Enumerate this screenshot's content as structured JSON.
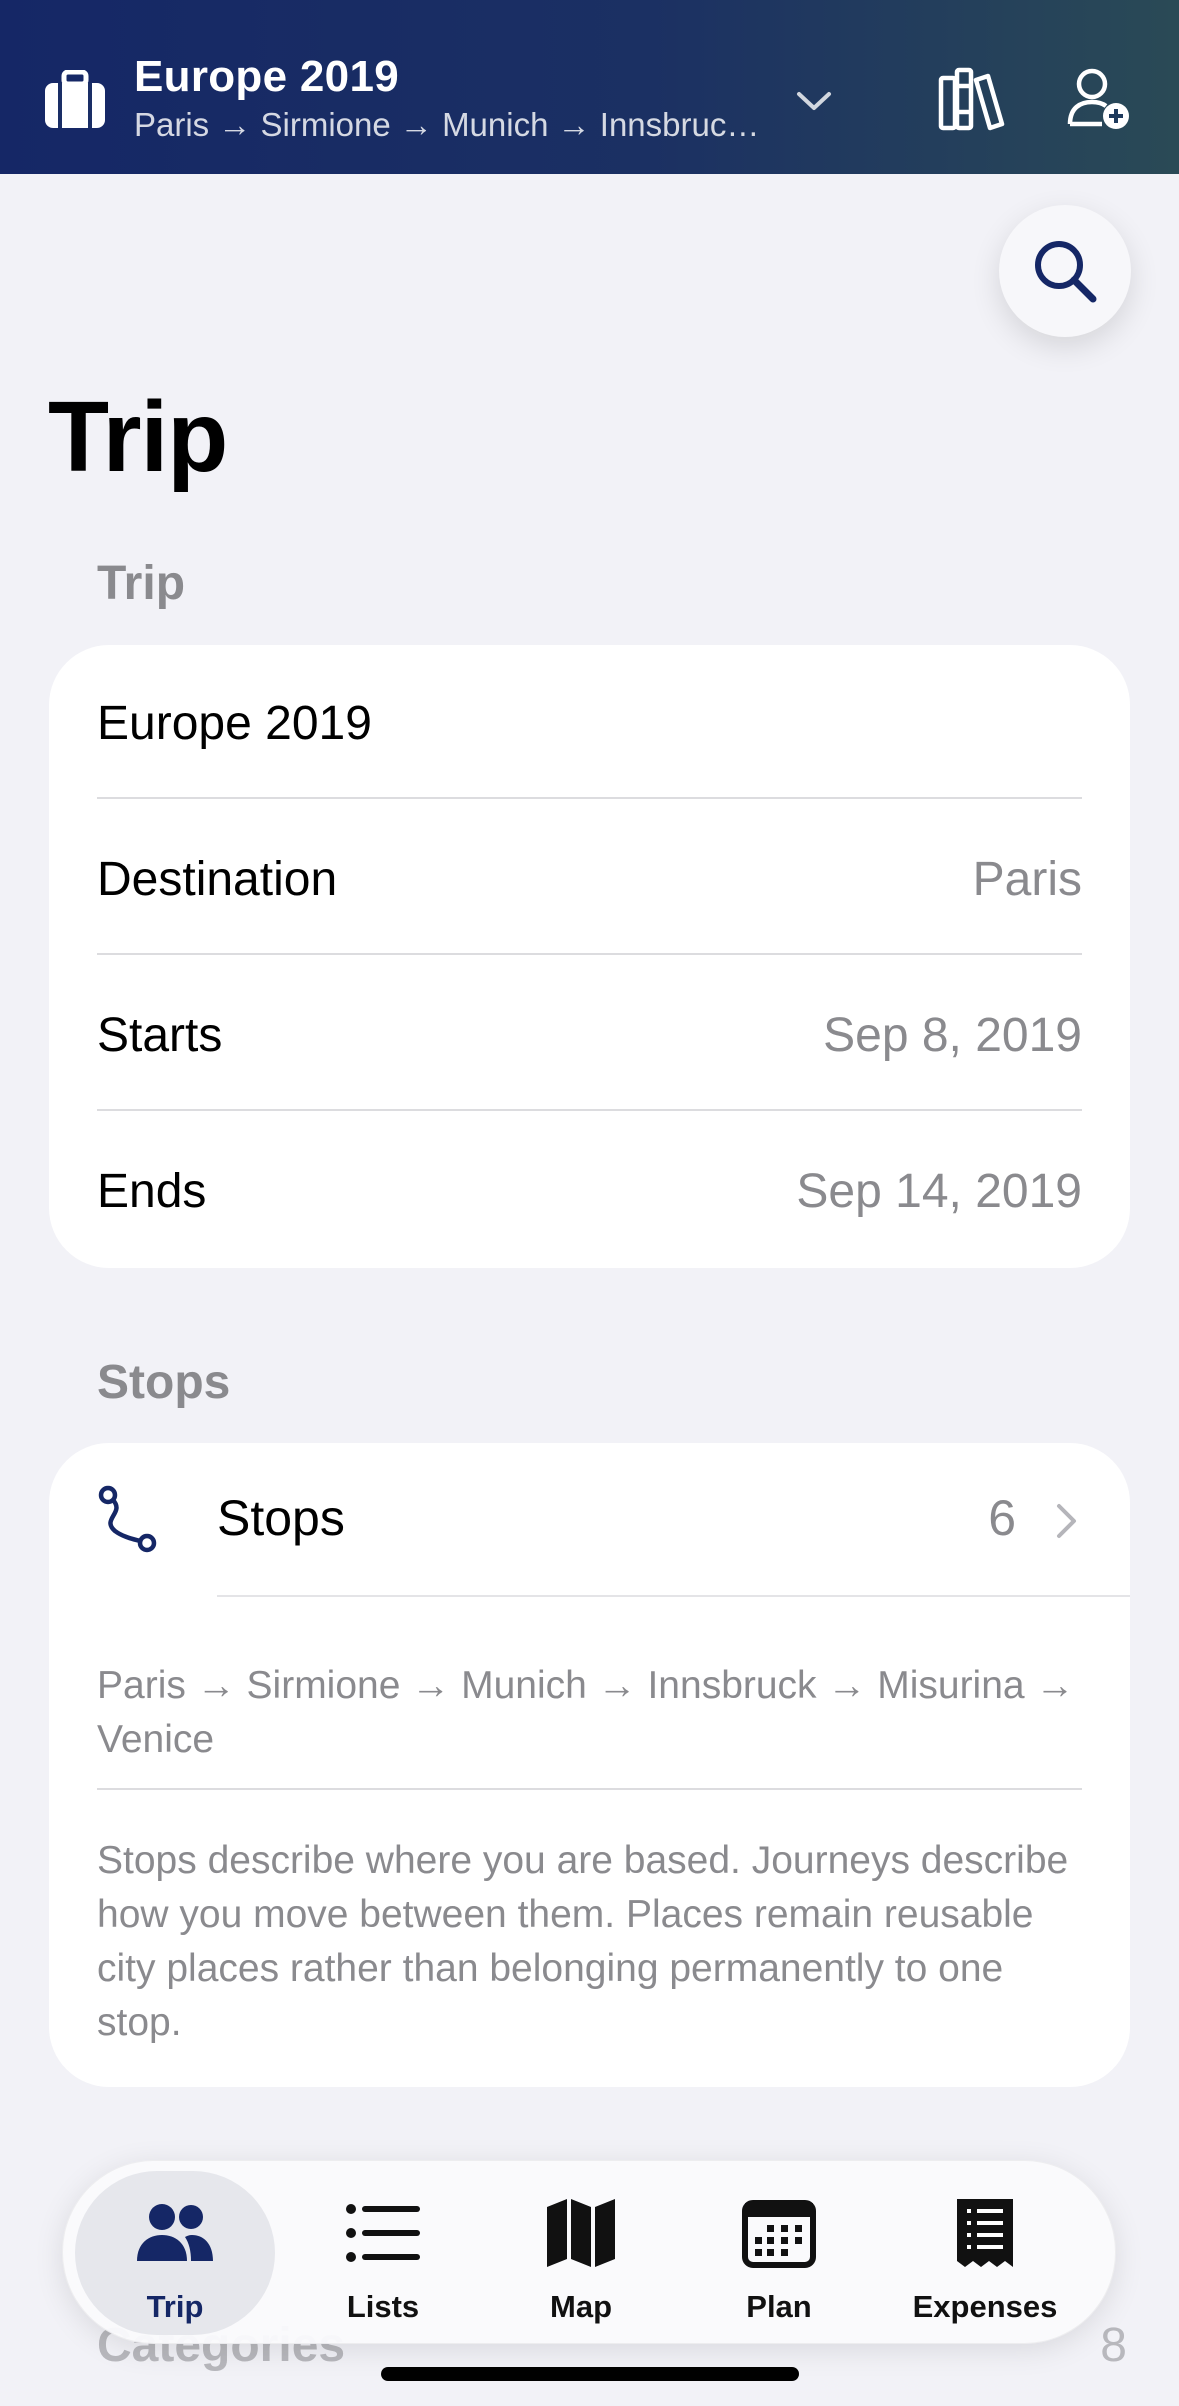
{
  "header": {
    "title": "Europe 2019",
    "route": "Paris → Sirmione → Munich → Innsbruc…"
  },
  "page": {
    "title": "Trip"
  },
  "trip_section": {
    "label": "Trip",
    "name": "Europe 2019",
    "rows": [
      {
        "label": "Destination",
        "value": "Paris"
      },
      {
        "label": "Starts",
        "value": "Sep 8, 2019"
      },
      {
        "label": "Ends",
        "value": "Sep 14, 2019"
      }
    ]
  },
  "stops_section": {
    "label": "Stops",
    "row_label": "Stops",
    "count": "6",
    "route": "Paris → Sirmione → Munich → Innsbruck → Misurina → Venice",
    "note": "Stops describe where you are based. Journeys describe how you move between them. Places remain reusable city places rather than belonging permanently to one stop."
  },
  "behind": {
    "label": "Categories",
    "count": "8"
  },
  "tabbar": {
    "active": "Trip",
    "tabs": [
      {
        "label": "Trip",
        "icon": "people-icon"
      },
      {
        "label": "Lists",
        "icon": "list-icon"
      },
      {
        "label": "Map",
        "icon": "map-icon"
      },
      {
        "label": "Plan",
        "icon": "calendar-icon"
      },
      {
        "label": "Expenses",
        "icon": "receipt-icon"
      }
    ]
  },
  "colors": {
    "brand": "#152766",
    "secondary_text": "#8a8a8e",
    "background": "#f2f2f7"
  }
}
